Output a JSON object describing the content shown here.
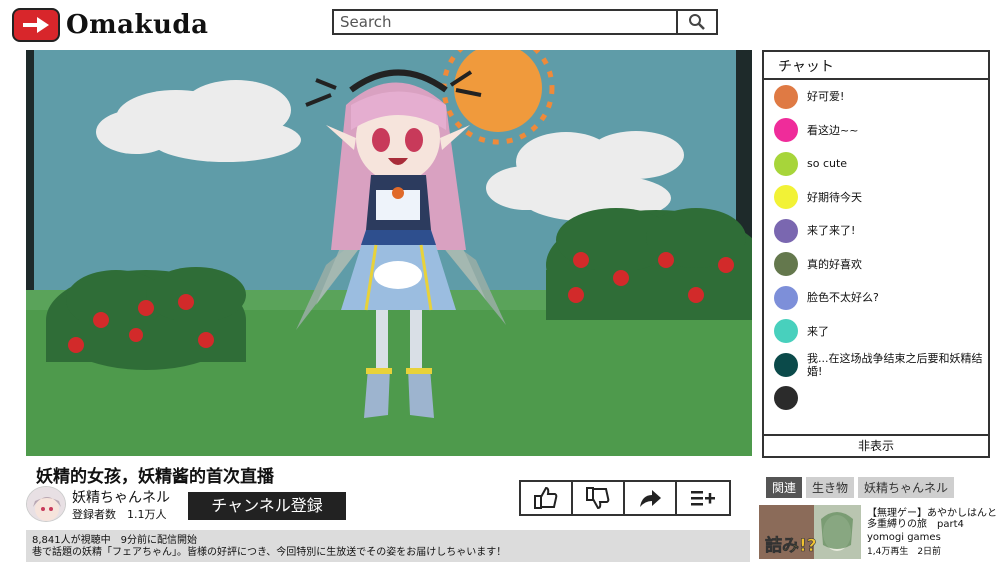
{
  "header": {
    "logo_text": "Omakuda",
    "search_placeholder": "Search",
    "icons": {
      "logo": "play-icon",
      "search": "search-icon"
    }
  },
  "chat": {
    "title": "チャット",
    "footer": "非表示",
    "messages": [
      {
        "text": "好可爱!",
        "color": "#df7a44"
      },
      {
        "text": "看这边~~",
        "color": "#ef2c9a"
      },
      {
        "text": "so cute",
        "color": "#a7d53a"
      },
      {
        "text": "好期待今天",
        "color": "#f2f236"
      },
      {
        "text": "来了来了!",
        "color": "#7a67b0"
      },
      {
        "text": "真的好喜欢",
        "color": "#64784d"
      },
      {
        "text": "脸色不太好么?",
        "color": "#7d8fd9"
      },
      {
        "text": "来了",
        "color": "#48d0bd"
      },
      {
        "text": "我...在这场战争结束之后要和妖精结婚!",
        "color": "#0b4a4a"
      },
      {
        "text": "",
        "color": "#2b2b2b"
      }
    ]
  },
  "video": {
    "title": "妖精的女孩，妖精酱的首次直播",
    "channel": "妖精ちゃんネル",
    "subscribers": "登録者数　1.1万人",
    "subscribe_label": "チャンネル登録",
    "actions": [
      "like-icon",
      "dislike-icon",
      "share-icon",
      "add-playlist-icon"
    ],
    "description_line1": "8,841人が視聴中　9分前に配信開始",
    "description_line2": "巷で話題の妖精「フェアちゃん」。皆様の好評につき、今回特別に生放送でその姿をお届けしちゃいます！"
  },
  "related": {
    "tabs": [
      "関連",
      "生き物",
      "妖精ちゃんネル"
    ],
    "active_tab": 0,
    "item": {
      "title": "【無理ゲー】あやかしはんと多重縛りの旅　part4",
      "channel": "yomogi games",
      "meta": "1,4万再生　2日前",
      "thumb_text": "詰み!?"
    }
  }
}
